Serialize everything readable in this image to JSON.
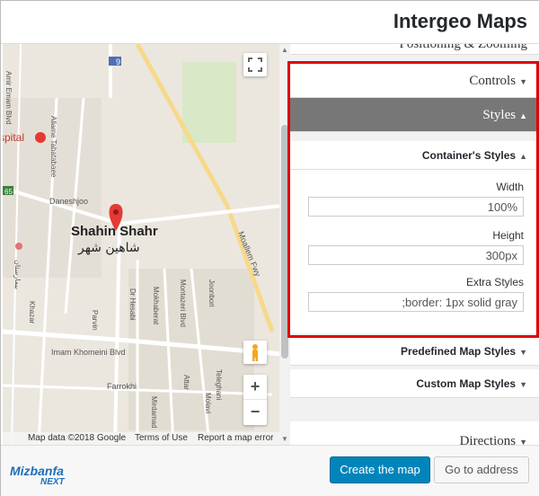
{
  "header": {
    "title": "Intergeo Maps"
  },
  "map": {
    "labels": {
      "city_en": "Shahin Shahr",
      "city_fa": "شاهین شهر",
      "road_9": "9",
      "road_65": "65",
      "moallem": "Moallem Fwy",
      "daneshjoo": "Daneshjoo",
      "allame": "Allame Tabatabaee",
      "emam": "Amir Emam Blvd",
      "imam_khomeini": "Imam Khomeini Blvd",
      "farrokhi": "Farrokhi",
      "dr_hesabi": "Dr Hesabi",
      "mokhaberat": "Mokhaberat",
      "montazeri": "Montazeri Blvd",
      "joonbori": "Joonbori",
      "parvin": "Parvin",
      "khazar": "Khazar",
      "attar": "Attar",
      "molavi": "Molavi",
      "mirdamad": "Mirdamad",
      "teleghani": "Teleghani",
      "hospital": "spital",
      "fa_left": "بیمارستان"
    },
    "footer": {
      "data": "Map data ©2018 Google",
      "terms": "Terms of Use",
      "report": "Report a map error"
    },
    "zoom_in": "+",
    "zoom_out": "−"
  },
  "panel": {
    "positioning": "Positioning & Zooming",
    "controls": "Controls",
    "styles": "Styles",
    "container_styles": "Container's Styles",
    "width_label": "Width",
    "width_value": "100%",
    "height_label": "Height",
    "height_value": "300px",
    "extra_label": "Extra Styles",
    "extra_value": ";border: 1px solid gray",
    "predefined": "Predefined Map Styles",
    "custom": "Custom Map Styles",
    "directions": "Directions"
  },
  "footer": {
    "logo_main": "Mizbanfa",
    "logo_sub": "NEXT",
    "create": "Create the map",
    "goto": "Go to address"
  },
  "colors": {
    "accent": "#0085ba",
    "highlight": "#e00000",
    "active_section": "#777777"
  }
}
